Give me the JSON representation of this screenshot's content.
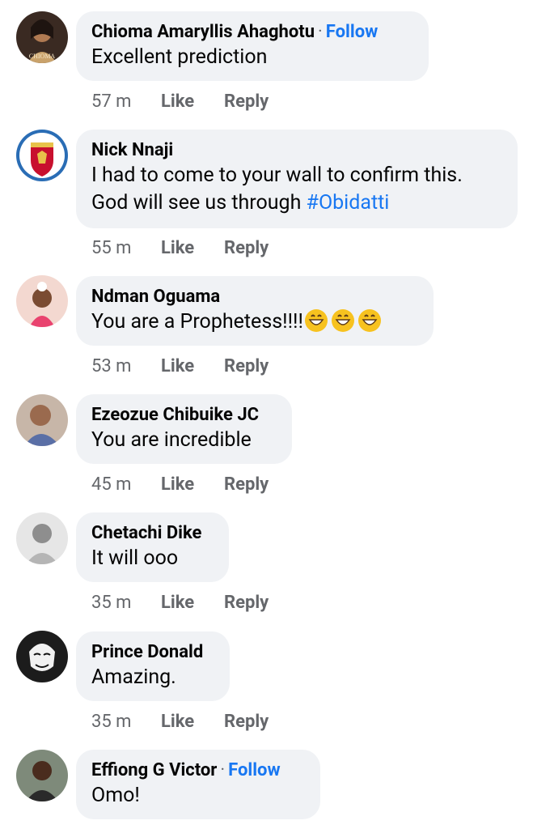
{
  "comments": [
    {
      "name": "Chioma Amaryllis Ahaghotu",
      "follow": "Follow",
      "text": "Excellent prediction",
      "time": "57 m",
      "like": "Like",
      "reply": "Reply",
      "avatar": "avatar-woman-portrait"
    },
    {
      "name": "Nick Nnaji",
      "text_prefix": "I had to come to your wall to confirm this. God will see us through ",
      "hashtag": "#Obidatti",
      "time": "55 m",
      "like": "Like",
      "reply": "Reply",
      "avatar": "avatar-liverpool-crest"
    },
    {
      "name": "Ndman Oguama",
      "text": "You are a Prophetess!!!!",
      "emoji": "grinning-face-icon",
      "time": "53 m",
      "like": "Like",
      "reply": "Reply",
      "avatar": "avatar-child-photo"
    },
    {
      "name": "Ezeozue Chibuike JC",
      "text": "You are incredible",
      "time": "45 m",
      "like": "Like",
      "reply": "Reply",
      "avatar": "avatar-child-photo"
    },
    {
      "name": "Chetachi Dike",
      "text": "It will ooo",
      "time": "35 m",
      "like": "Like",
      "reply": "Reply",
      "avatar": "avatar-grayscale-man"
    },
    {
      "name": "Prince Donald",
      "text": "Amazing.",
      "time": "35 m",
      "like": "Like",
      "reply": "Reply",
      "avatar": "avatar-anonymous-mask"
    },
    {
      "name": "Effiong G Victor",
      "follow": "Follow",
      "text": "Omo!",
      "avatar": "avatar-man-photo"
    }
  ],
  "colors": {
    "bubble": "#f0f2f5",
    "link": "#1877f2",
    "meta": "#65676b"
  }
}
